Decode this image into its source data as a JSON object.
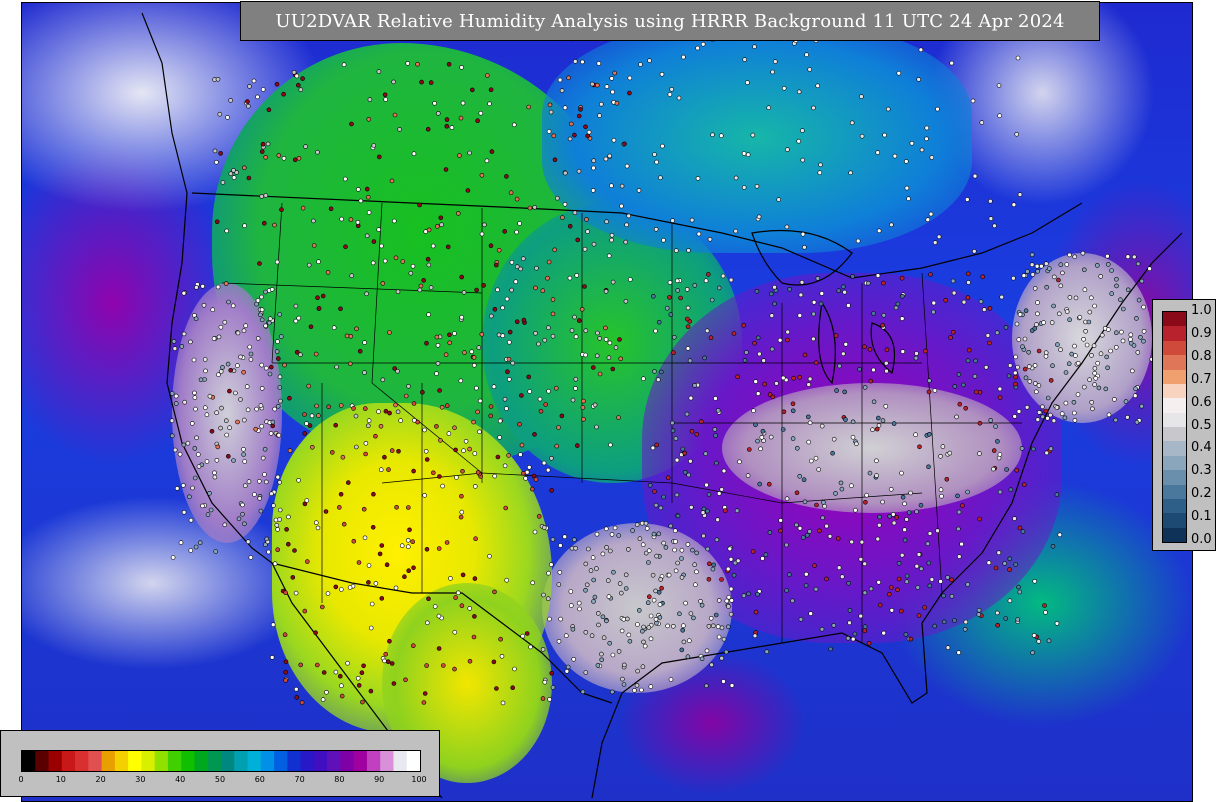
{
  "title": "UU2DVAR Relative Humidity Analysis using HRRR Background 11 UTC 24 Apr 2024",
  "obs_legend": {
    "labels": [
      "1.0",
      "0.9",
      "0.8",
      "0.7",
      "0.6",
      "0.5",
      "0.4",
      "0.3",
      "0.2",
      "0.1",
      "0.0"
    ],
    "colors": [
      "#8b0a1a",
      "#b8222d",
      "#cf4a3a",
      "#e07658",
      "#f0a06f",
      "#f7d3c0",
      "#f5f0ef",
      "#e6e6e8",
      "#c8c8cc",
      "#a8b7c7",
      "#8aa6bc",
      "#6a8fad",
      "#4a789c",
      "#2e5f88",
      "#1c4a72",
      "#0f3358"
    ]
  },
  "rh_scale": {
    "ticks": [
      "0",
      "10",
      "20",
      "30",
      "40",
      "50",
      "60",
      "70",
      "80",
      "90",
      "100"
    ],
    "colors": [
      "#000000",
      "#5a0000",
      "#9b0000",
      "#c81818",
      "#d83030",
      "#e05050",
      "#e8a000",
      "#f4d000",
      "#ffff00",
      "#d8f000",
      "#90e000",
      "#40d000",
      "#10c000",
      "#00a820",
      "#009850",
      "#008880",
      "#00a0b0",
      "#00b0d8",
      "#0090e8",
      "#0060e0",
      "#1030d0",
      "#2818c8",
      "#4010c0",
      "#6010b8",
      "#8000a8",
      "#a000a0",
      "#c040c0",
      "#d890d8",
      "#e8e8f0",
      "#ffffff"
    ]
  }
}
